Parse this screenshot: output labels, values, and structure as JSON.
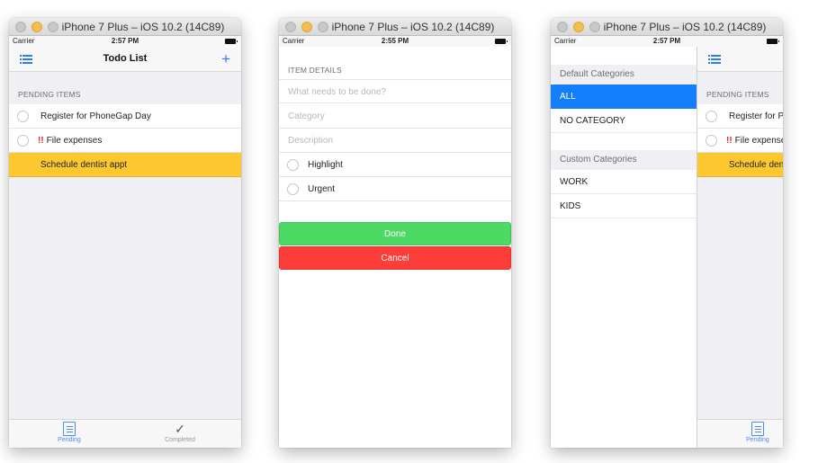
{
  "window_title": "iPhone 7 Plus – iOS 10.2 (14C89)",
  "screen1": {
    "status": {
      "carrier": "Carrier",
      "time": "2:57 PM"
    },
    "nav_title": "Todo List",
    "plus_label": "+",
    "section_header": "PENDING ITEMS",
    "items": [
      {
        "bang": "",
        "label": "Register for PhoneGap Day"
      },
      {
        "bang": "!!",
        "label": "File expenses"
      },
      {
        "bang": "",
        "label": "Schedule dentist appt"
      }
    ],
    "tabs": [
      {
        "label": "Pending",
        "icon": "list-document-icon",
        "color": "#4a8cf7"
      },
      {
        "label": "Completed",
        "icon": "checkmark-icon",
        "color": "#9a9a9a"
      }
    ]
  },
  "screen2": {
    "status": {
      "carrier": "Carrier",
      "time": "2:55 PM"
    },
    "section_header": "ITEM DETAILS",
    "fields": [
      {
        "placeholder": "What needs to be done?"
      },
      {
        "placeholder": "Category"
      },
      {
        "placeholder": "Description"
      }
    ],
    "toggles": [
      {
        "label": "Highlight"
      },
      {
        "label": "Urgent"
      }
    ],
    "done_label": "Done",
    "cancel_label": "Cancel"
  },
  "screen3": {
    "status": {
      "carrier": "Carrier",
      "time": "2:57 PM"
    },
    "default_header": "Default Categories",
    "default_items": [
      "ALL",
      "NO CATEGORY"
    ],
    "custom_header": "Custom Categories",
    "custom_items": [
      "WORK",
      "KIDS"
    ],
    "behind": {
      "section_header": "PENDING ITEMS",
      "items": [
        {
          "bang": "",
          "label": "Register for PhoneGap Day"
        },
        {
          "bang": "!!",
          "label": "File expenses"
        },
        {
          "bang": "",
          "label": "Schedule dentist appt"
        }
      ],
      "tab_label": "Pending"
    }
  },
  "colors": {
    "accent": "#2f7cf6",
    "highlight": "#fdc82f",
    "done": "#4cd964",
    "cancel": "#fc3d39",
    "selected": "#147efb"
  }
}
